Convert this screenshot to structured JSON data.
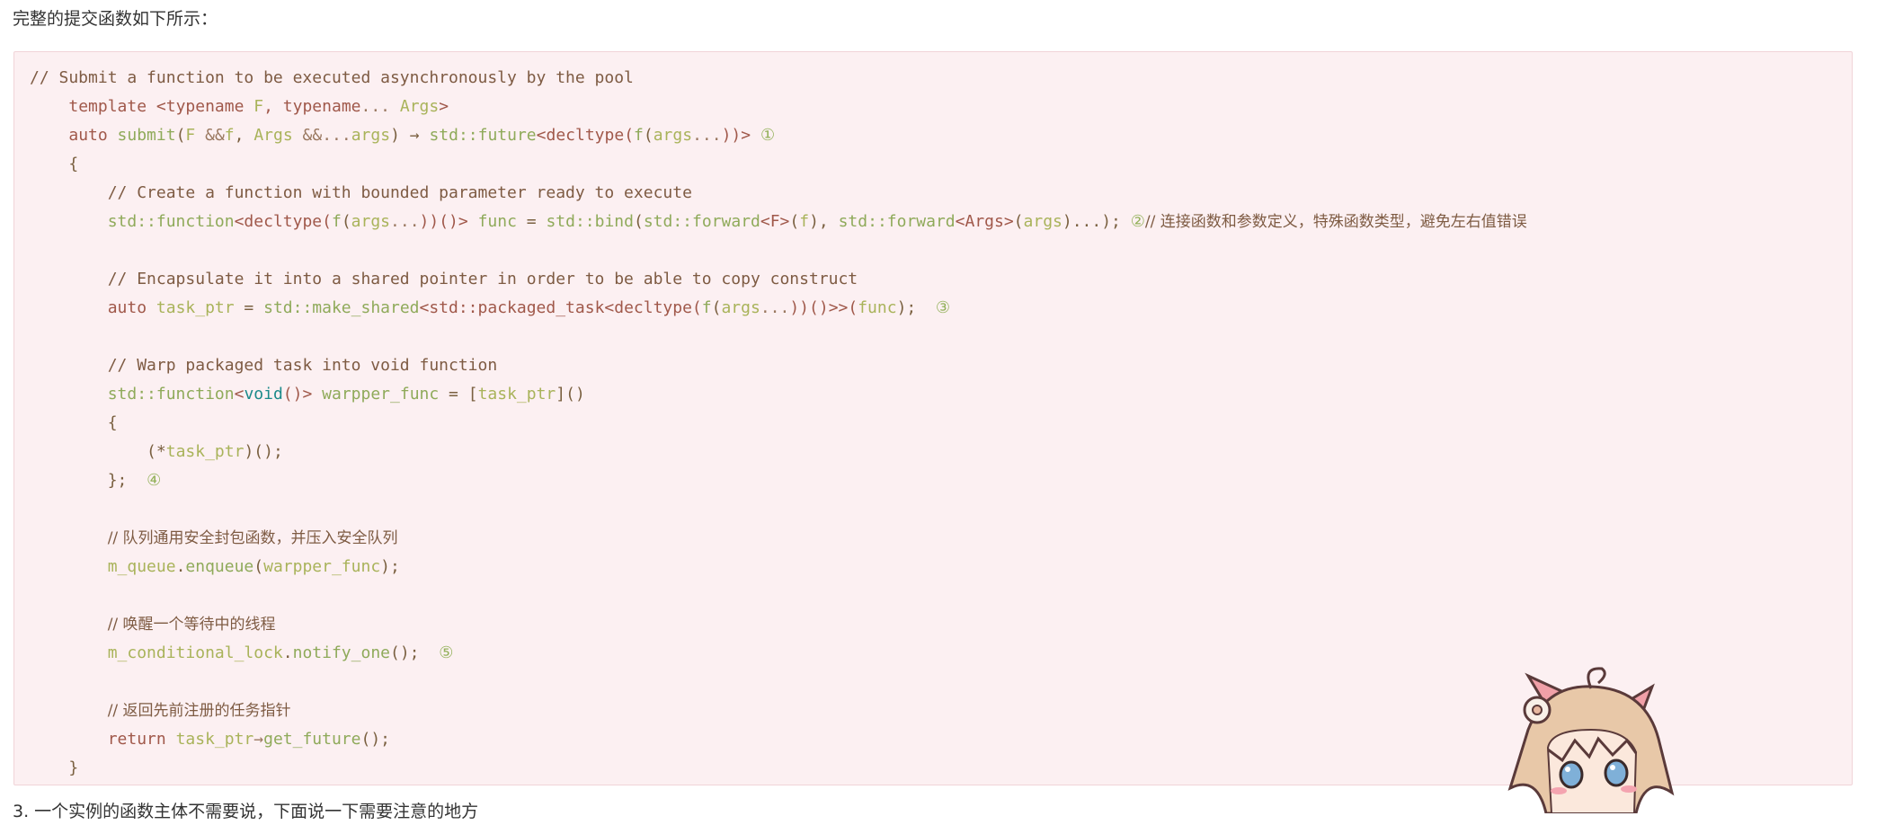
{
  "intro_text": "完整的提交函数如下所示：",
  "outro_text": "3. 一个实例的函数主体不需要说，下面说一下需要注意的地方",
  "code": {
    "l1": "// Submit a function to be executed asynchronously by the pool",
    "l2_a": "template ",
    "l2_b": "<typename ",
    "l2_c": "F",
    "l2_d": ", typename",
    "l2_e": "... ",
    "l2_f": "Args",
    "l2_g": ">",
    "l3_a": "auto ",
    "l3_b": "submit",
    "l3_c": "(",
    "l3_d": "F ",
    "l3_e": "&&",
    "l3_f": "f",
    "l3_g": ", ",
    "l3_h": "Args ",
    "l3_i": "&&",
    "l3_j": "...",
    "l3_k": "args",
    "l3_l": ") → ",
    "l3_m": "std::future",
    "l3_n": "<decltype(",
    "l3_o": "f",
    "l3_p": "(",
    "l3_q": "args",
    "l3_r": "...",
    "l3_s": "))>",
    "l3_mark": "①",
    "l4": "{",
    "l5": "// Create a function with bounded parameter ready to execute",
    "l6_a": "std::function",
    "l6_b": "<decltype(",
    "l6_c": "f",
    "l6_d": "(",
    "l6_e": "args",
    "l6_f": "...",
    "l6_g": "))()> ",
    "l6_h": "func",
    "l6_i": " = ",
    "l6_j": "std::bind",
    "l6_k": "(",
    "l6_l": "std::forward",
    "l6_m": "<F>",
    "l6_n": "(",
    "l6_o": "f",
    "l6_p": "), ",
    "l6_q": "std::forward",
    "l6_r": "<Args>",
    "l6_s": "(",
    "l6_t": "args",
    "l6_u": ")...); ",
    "l6_mark": "②",
    "l6_cmt": "// 连接函数和参数定义，特殊函数类型，避免左右值错误",
    "l8": "// Encapsulate it into a shared pointer in order to be able to copy construct",
    "l9_a": "auto ",
    "l9_b": "task_ptr",
    "l9_c": " = ",
    "l9_d": "std::make_shared",
    "l9_e": "<std::packaged_task<decltype(",
    "l9_f": "f",
    "l9_g": "(",
    "l9_h": "args",
    "l9_i": "...",
    "l9_j": "))()>>(",
    "l9_k": "func",
    "l9_l": ");  ",
    "l9_mark": "③",
    "l11": "// Warp packaged task into void function",
    "l12_a": "std::function",
    "l12_b": "<",
    "l12_c": "void",
    "l12_d": "()> ",
    "l12_e": "warpper_func",
    "l12_f": " = [",
    "l12_g": "task_ptr",
    "l12_h": "]()",
    "l13": "{",
    "l14_a": "(*",
    "l14_b": "task_ptr",
    "l14_c": ")();",
    "l15_a": "};  ",
    "l15_mark": "④",
    "l17": "// 队列通用安全封包函数，并压入安全队列",
    "l18_a": "m_queue",
    "l18_b": ".",
    "l18_c": "enqueue",
    "l18_d": "(",
    "l18_e": "warpper_func",
    "l18_f": ");",
    "l20": "// 唤醒一个等待中的线程",
    "l21_a": "m_conditional_lock",
    "l21_b": ".",
    "l21_c": "notify_one",
    "l21_d": "();  ",
    "l21_mark": "⑤",
    "l23": "// 返回先前注册的任务指针",
    "l24_a": "return ",
    "l24_b": "task_ptr",
    "l24_c": "→",
    "l24_d": "get_future",
    "l24_e": "();",
    "l25": "}"
  }
}
